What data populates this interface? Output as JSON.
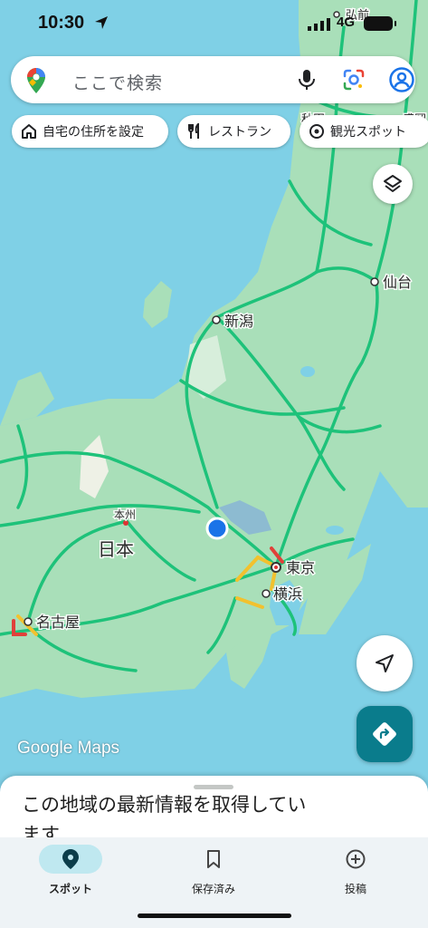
{
  "status": {
    "time": "10:30",
    "network": "4G"
  },
  "search": {
    "placeholder": "ここで検索"
  },
  "chips": [
    {
      "label": "自宅の住所を設定",
      "icon": "home-icon"
    },
    {
      "label": "レストラン",
      "icon": "restaurant-icon"
    },
    {
      "label": "観光スポット",
      "icon": "landmark-icon"
    }
  ],
  "map": {
    "labels": {
      "sendai": "仙台",
      "niigata": "新潟",
      "nihon": "日本",
      "honshu": "本州",
      "tokyo": "東京",
      "yokohama": "横浜",
      "nagoya": "名古屋",
      "hirosaki": "弘前",
      "akita": "秋田",
      "morioka": "盛岡"
    }
  },
  "brand": {
    "google": "Google",
    "maps": "Maps"
  },
  "sheet": {
    "title": "この地域の最新情報を取得しています..."
  },
  "nav": [
    {
      "label": "スポット",
      "icon": "location-pin-icon",
      "active": true
    },
    {
      "label": "保存済み",
      "icon": "bookmark-icon",
      "active": false
    },
    {
      "label": "投稿",
      "icon": "add-circle-icon",
      "active": false
    }
  ],
  "colors": {
    "water": "#7fd0e6",
    "land": "#a9dfb9",
    "highway": "#1ec27a",
    "accent": "#0a7c8c"
  }
}
